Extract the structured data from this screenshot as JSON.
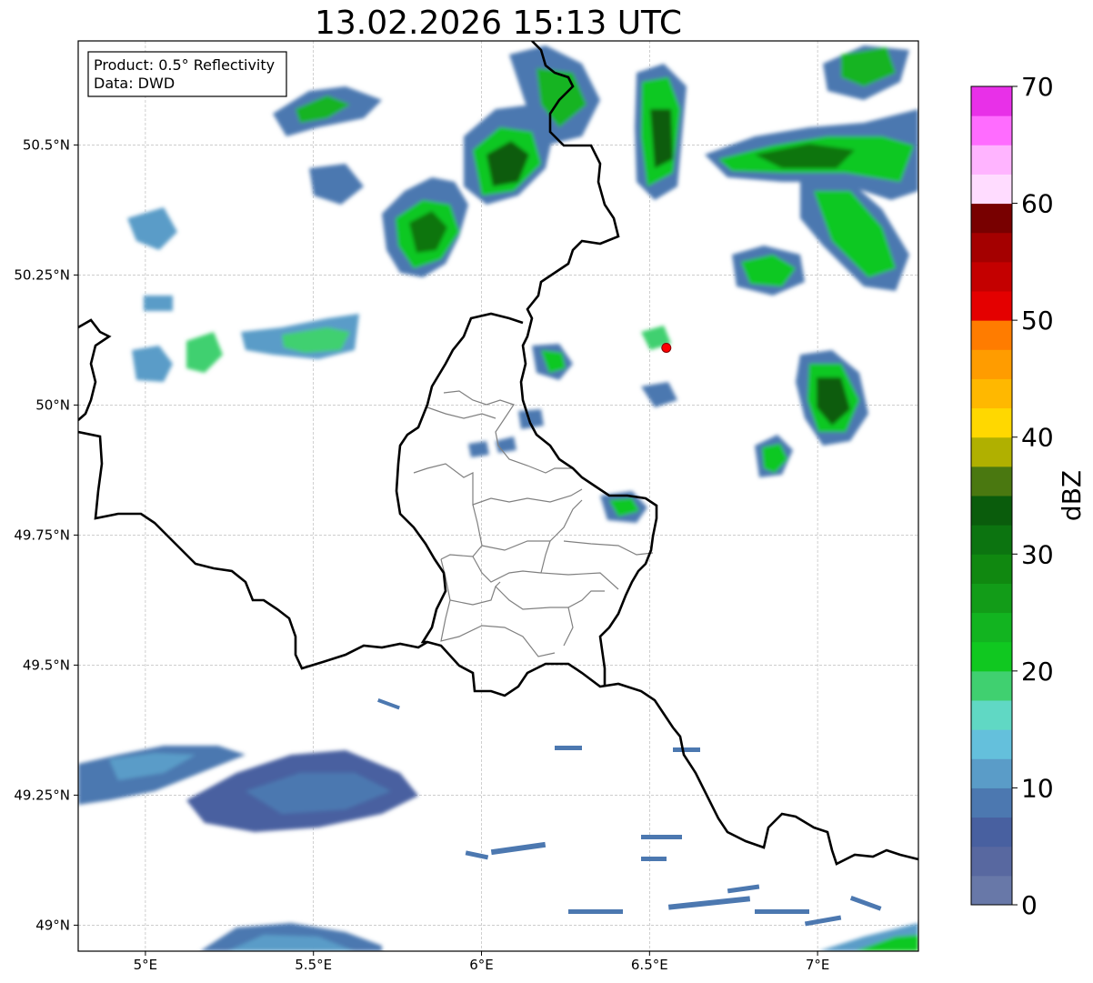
{
  "title": "13.02.2026 15:13 UTC",
  "info_box": {
    "line1": "Product: 0.5° Reflectivity",
    "line2": "Data: DWD"
  },
  "map": {
    "lon_range": [
      4.8,
      7.3
    ],
    "lat_range": [
      48.95,
      50.7
    ],
    "lon_ticks": [
      {
        "value": 5.0,
        "label": "5°E"
      },
      {
        "value": 5.5,
        "label": "5.5°E"
      },
      {
        "value": 6.0,
        "label": "6°E"
      },
      {
        "value": 6.5,
        "label": "6.5°E"
      },
      {
        "value": 7.0,
        "label": "7°E"
      }
    ],
    "lat_ticks": [
      {
        "value": 50.5,
        "label": "50.5°N"
      },
      {
        "value": 50.25,
        "label": "50.25°N"
      },
      {
        "value": 50.0,
        "label": "50°N"
      },
      {
        "value": 49.75,
        "label": "49.75°N"
      },
      {
        "value": 49.5,
        "label": "49.5°N"
      },
      {
        "value": 49.25,
        "label": "49.25°N"
      },
      {
        "value": 49.0,
        "label": "49°N"
      }
    ],
    "radar_site": {
      "lon": 6.55,
      "lat": 50.11,
      "color": "#ff0000"
    }
  },
  "colorbar": {
    "label": "dBZ",
    "min": 0,
    "max": 70,
    "ticks": [
      {
        "value": 0,
        "label": "0"
      },
      {
        "value": 10,
        "label": "10"
      },
      {
        "value": 20,
        "label": "20"
      },
      {
        "value": 30,
        "label": "30"
      },
      {
        "value": 40,
        "label": "40"
      },
      {
        "value": 50,
        "label": "50"
      },
      {
        "value": 60,
        "label": "60"
      },
      {
        "value": 70,
        "label": "70"
      }
    ],
    "colors": [
      "#6878a8",
      "#5868a0",
      "#4860a0",
      "#4c78b0",
      "#5a9cc8",
      "#64c0dc",
      "#60d8c4",
      "#40d070",
      "#10c820",
      "#12b420",
      "#129c18",
      "#108810",
      "#0c7410",
      "#0a5c0c",
      "#4a7810",
      "#b0b000",
      "#ffd800",
      "#ffb800",
      "#ff9c00",
      "#ff7c00",
      "#e40000",
      "#c40000",
      "#a40000",
      "#780000",
      "#ffdcff",
      "#ffb4ff",
      "#ff6cff",
      "#e830e8"
    ]
  },
  "precip_cells": [
    {
      "lon": 5.75,
      "lat": 50.38,
      "rlon": 0.12,
      "rlat": 0.12,
      "dbz": 28
    },
    {
      "lon": 6.1,
      "lat": 50.44,
      "rlon": 0.11,
      "rlat": 0.1,
      "dbz": 30
    },
    {
      "lon": 6.55,
      "lat": 50.52,
      "rlon": 0.06,
      "rlat": 0.12,
      "dbz": 30
    },
    {
      "lon": 7.0,
      "lat": 50.47,
      "rlon": 0.16,
      "rlat": 0.05,
      "dbz": 28
    },
    {
      "lon": 7.1,
      "lat": 50.3,
      "rlon": 0.14,
      "rlat": 0.07,
      "dbz": 26
    },
    {
      "lon": 6.85,
      "lat": 50.25,
      "rlon": 0.07,
      "rlat": 0.05,
      "dbz": 32
    },
    {
      "lon": 7.05,
      "lat": 50.0,
      "rlon": 0.07,
      "rlat": 0.07,
      "dbz": 30
    },
    {
      "lon": 6.88,
      "lat": 49.88,
      "rlon": 0.05,
      "rlat": 0.04,
      "dbz": 26
    },
    {
      "lon": 5.55,
      "lat": 50.12,
      "rlon": 0.1,
      "rlat": 0.04,
      "dbz": 22
    },
    {
      "lon": 5.5,
      "lat": 49.27,
      "rlon": 0.3,
      "rlat": 0.05,
      "dbz": 10
    }
  ]
}
